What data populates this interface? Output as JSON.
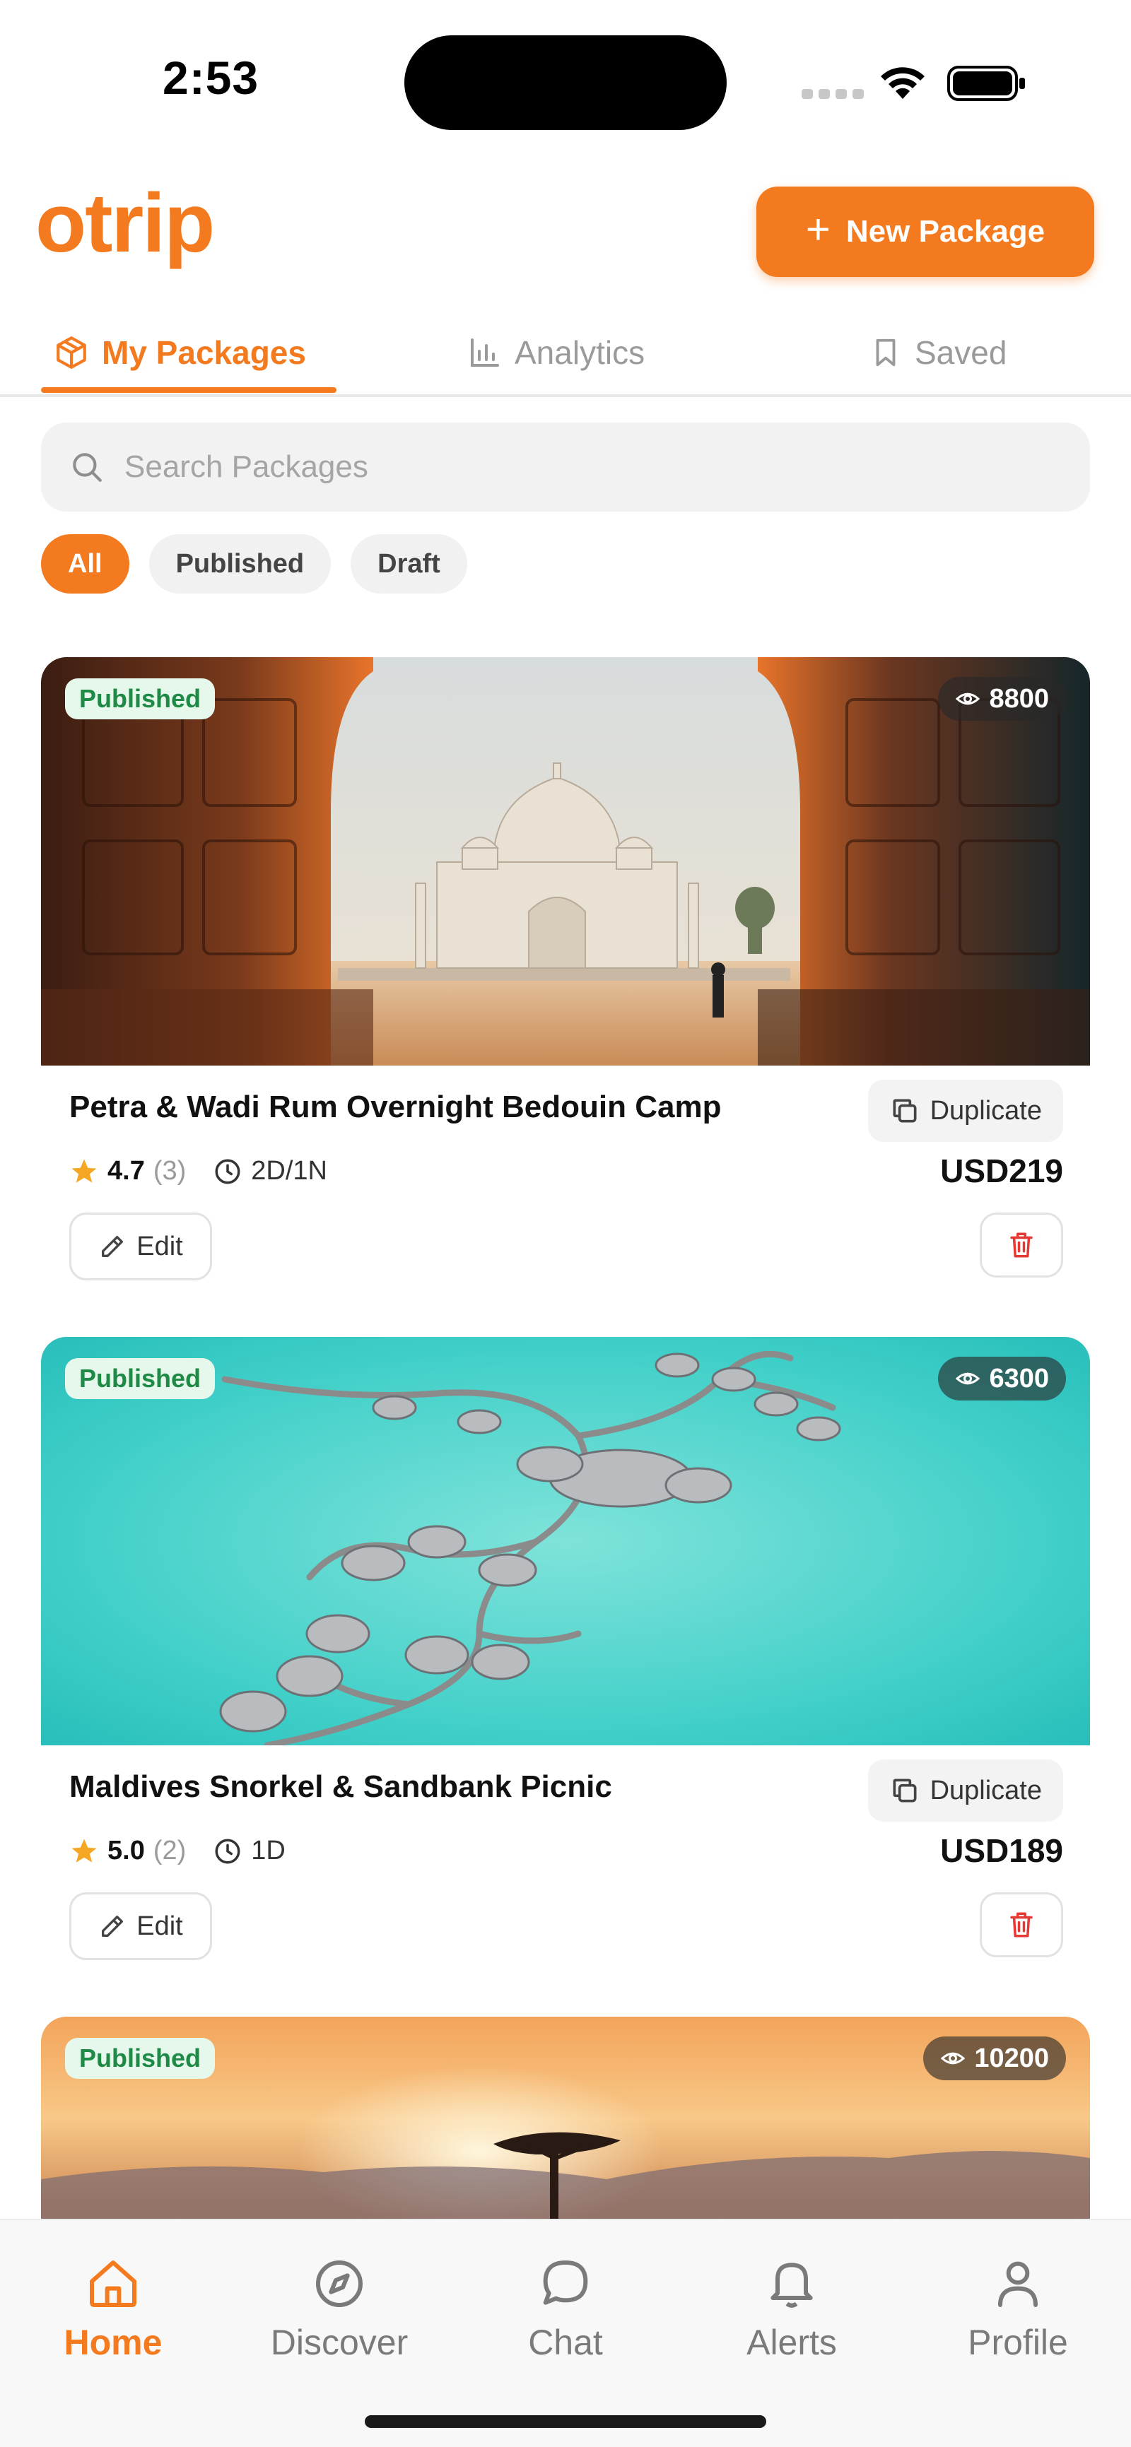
{
  "status_bar": {
    "time": "2:53"
  },
  "header": {
    "logo": "otrip",
    "new_package_label": "New Package"
  },
  "colors": {
    "accent": "#f47a1f",
    "published_bg": "#e6f7ec",
    "published_text": "#1f8a45",
    "delete_red": "#e53935",
    "star": "#f5a623"
  },
  "tabs": [
    {
      "label": "My Packages",
      "icon": "box-icon",
      "active": true
    },
    {
      "label": "Analytics",
      "icon": "bar-chart-icon",
      "active": false
    },
    {
      "label": "Saved",
      "icon": "bookmark-icon",
      "active": false
    }
  ],
  "search": {
    "placeholder": "Search Packages",
    "value": ""
  },
  "filters": [
    {
      "label": "All",
      "active": true
    },
    {
      "label": "Published",
      "active": false
    },
    {
      "label": "Draft",
      "active": false
    }
  ],
  "packages": [
    {
      "status": "Published",
      "views": "8800",
      "title": "Petra & Wadi Rum Overnight Bedouin Camp",
      "duplicate_label": "Duplicate",
      "rating": "4.7",
      "rating_count": "(3)",
      "duration": "2D/1N",
      "price": "USD219",
      "edit_label": "Edit",
      "image": "taj-mahal-gate"
    },
    {
      "status": "Published",
      "views": "6300",
      "title": "Maldives Snorkel & Sandbank Picnic",
      "duplicate_label": "Duplicate",
      "rating": "5.0",
      "rating_count": "(2)",
      "duration": "1D",
      "price": "USD189",
      "edit_label": "Edit",
      "image": "overwater-villas"
    },
    {
      "status": "Published",
      "views": "10200",
      "image": "savanna-sunset"
    }
  ],
  "bottom_nav": [
    {
      "label": "Home",
      "icon": "home-icon",
      "active": true
    },
    {
      "label": "Discover",
      "icon": "compass-icon",
      "active": false
    },
    {
      "label": "Chat",
      "icon": "chat-icon",
      "active": false
    },
    {
      "label": "Alerts",
      "icon": "bell-icon",
      "active": false
    },
    {
      "label": "Profile",
      "icon": "user-icon",
      "active": false
    }
  ]
}
